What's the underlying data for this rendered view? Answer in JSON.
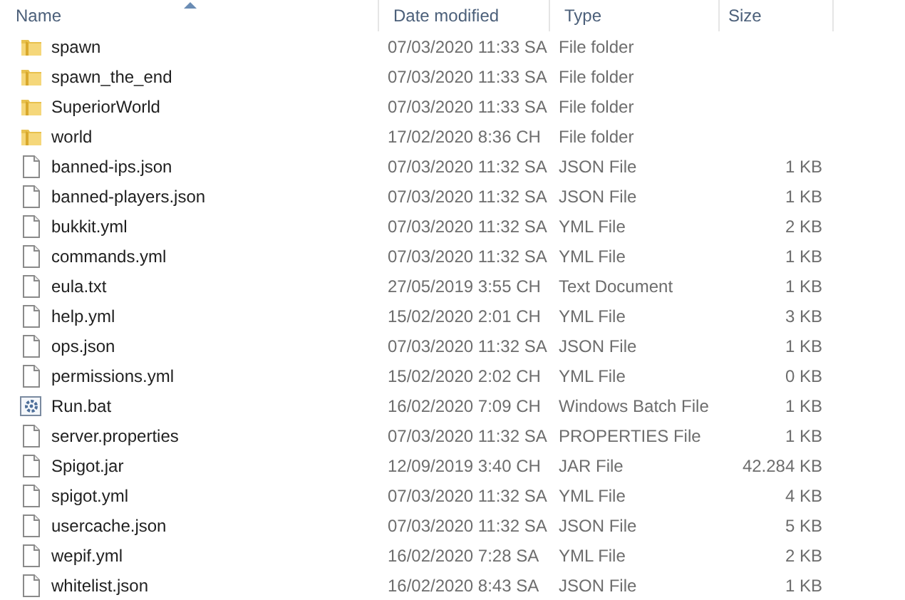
{
  "columns": [
    {
      "label": "Name",
      "sorted": true
    },
    {
      "label": "Date modified",
      "sorted": false
    },
    {
      "label": "Type",
      "sorted": false
    },
    {
      "label": "Size",
      "sorted": false
    }
  ],
  "files": [
    {
      "kind": "folder",
      "name": "spawn",
      "date": "07/03/2020 11:33 SA",
      "type": "File folder"
    },
    {
      "kind": "folder",
      "name": "spawn_the_end",
      "date": "07/03/2020 11:33 SA",
      "type": "File folder"
    },
    {
      "kind": "folder",
      "name": "SuperiorWorld",
      "date": "07/03/2020 11:33 SA",
      "type": "File folder"
    },
    {
      "kind": "folder",
      "name": "world",
      "date": "17/02/2020 8:36 CH",
      "type": "File folder"
    },
    {
      "kind": "file",
      "name": "banned-ips.json",
      "date": "07/03/2020 11:32 SA",
      "type": "JSON File",
      "size": "1 KB"
    },
    {
      "kind": "file",
      "name": "banned-players.json",
      "date": "07/03/2020 11:32 SA",
      "type": "JSON File",
      "size": "1 KB"
    },
    {
      "kind": "file",
      "name": "bukkit.yml",
      "date": "07/03/2020 11:32 SA",
      "type": "YML File",
      "size": "2 KB"
    },
    {
      "kind": "file",
      "name": "commands.yml",
      "date": "07/03/2020 11:32 SA",
      "type": "YML File",
      "size": "1 KB"
    },
    {
      "kind": "file",
      "name": "eula.txt",
      "date": "27/05/2019 3:55 CH",
      "type": "Text Document",
      "size": "1 KB"
    },
    {
      "kind": "file",
      "name": "help.yml",
      "date": "15/02/2020 2:01 CH",
      "type": "YML File",
      "size": "3 KB"
    },
    {
      "kind": "file",
      "name": "ops.json",
      "date": "07/03/2020 11:32 SA",
      "type": "JSON File",
      "size": "1 KB"
    },
    {
      "kind": "file",
      "name": "permissions.yml",
      "date": "15/02/2020 2:02 CH",
      "type": "YML File",
      "size": "0 KB"
    },
    {
      "kind": "batch",
      "name": "Run.bat",
      "date": "16/02/2020 7:09 CH",
      "type": "Windows Batch File",
      "size": "1 KB"
    },
    {
      "kind": "file",
      "name": "server.properties",
      "date": "07/03/2020 11:32 SA",
      "type": "PROPERTIES File",
      "size": "1 KB"
    },
    {
      "kind": "file",
      "name": "Spigot.jar",
      "date": "12/09/2019 3:40 CH",
      "type": "JAR File",
      "size": "42.284 KB"
    },
    {
      "kind": "file",
      "name": "spigot.yml",
      "date": "07/03/2020 11:32 SA",
      "type": "YML File",
      "size": "4 KB"
    },
    {
      "kind": "file",
      "name": "usercache.json",
      "date": "07/03/2020 11:32 SA",
      "type": "JSON File",
      "size": "5 KB"
    },
    {
      "kind": "file",
      "name": "wepif.yml",
      "date": "16/02/2020 7:28 SA",
      "type": "YML File",
      "size": "2 KB"
    },
    {
      "kind": "file",
      "name": "whitelist.json",
      "date": "16/02/2020 8:43 SA",
      "type": "JSON File",
      "size": "1 KB"
    }
  ]
}
